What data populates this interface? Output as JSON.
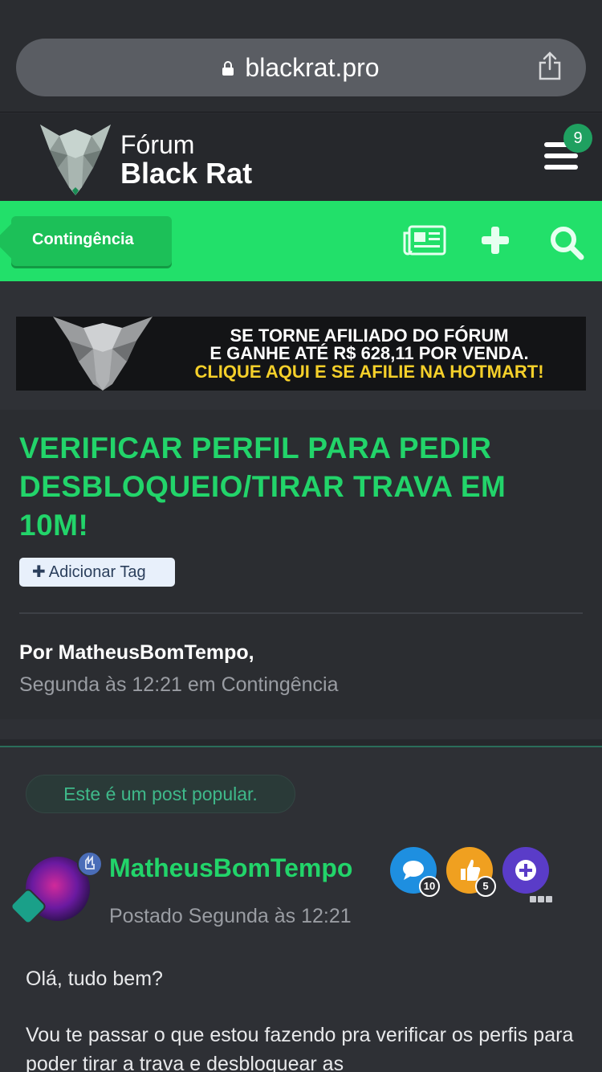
{
  "browser": {
    "url": "blackrat.pro"
  },
  "forum": {
    "logo_line1": "Fórum",
    "logo_line2": "Black Rat",
    "notification_count": "9"
  },
  "nav": {
    "breadcrumb": "Contingência"
  },
  "banner": {
    "line1": "SE TORNE AFILIADO DO FÓRUM",
    "line2": "E GANHE ATÉ R$ 628,11 POR VENDA.",
    "line3": "CLIQUE AQUI E SE AFILIE NA HOTMART!"
  },
  "topic": {
    "title": "VERIFICAR PERFIL PARA PEDIR DESBLOQUEIO/TIRAR TRAVA EM 10M!",
    "add_tag_label": "Adicionar Tag",
    "author_line": "Por MatheusBomTempo,",
    "date_line": "Segunda às 12:21 em Contingência"
  },
  "post": {
    "popular_label": "Este é um post popular.",
    "username": "MatheusBomTempo",
    "posted": "Postado Segunda às 12:21",
    "achievements": [
      {
        "icon": "comment-icon",
        "count": "10",
        "color": "#1e8fe0"
      },
      {
        "icon": "thumbs-up-icon",
        "count": "5",
        "color": "#f0a020"
      },
      {
        "icon": "plus-icon",
        "count": "",
        "color": "#5a3cc8"
      }
    ],
    "body": [
      "Olá, tudo bem?",
      "Vou te passar o que estou fazendo pra verificar os perfis para poder tirar a trava e desbloquear as"
    ]
  },
  "colors": {
    "accent_green": "#22e06a",
    "title_green": "#22d46a",
    "background": "#2b2d31"
  }
}
